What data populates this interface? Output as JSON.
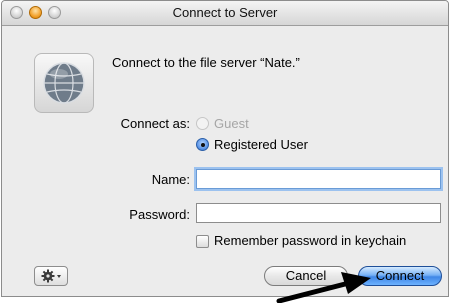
{
  "window": {
    "title": "Connect to Server"
  },
  "message": "Connect to the file server “Nate.”",
  "connect_as": {
    "label": "Connect as:",
    "options": [
      {
        "label": "Guest",
        "selected": false,
        "enabled": false
      },
      {
        "label": "Registered User",
        "selected": true,
        "enabled": true
      }
    ]
  },
  "fields": {
    "name": {
      "label": "Name:",
      "value": ""
    },
    "password": {
      "label": "Password:",
      "value": ""
    }
  },
  "remember": {
    "label": "Remember password in keychain",
    "checked": false
  },
  "buttons": {
    "cancel": "Cancel",
    "connect": "Connect"
  },
  "icons": {
    "server": "globe-icon",
    "action": "gear-icon",
    "annotation": "arrow-icon"
  },
  "colors": {
    "accent": "#3f86e6",
    "focus_ring": "#9cc2ef",
    "traffic_orange": "#f2a22d"
  }
}
